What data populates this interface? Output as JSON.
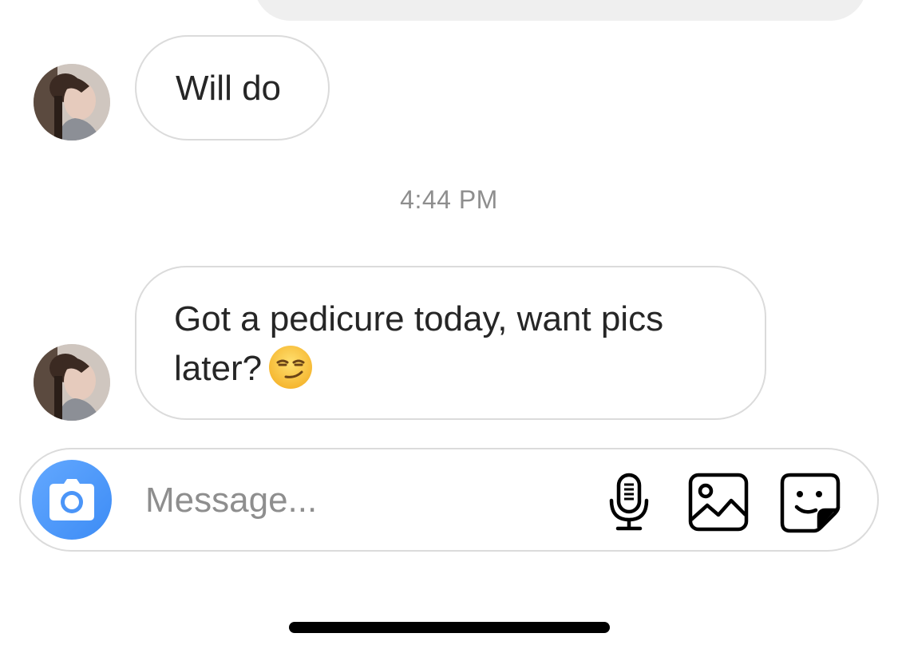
{
  "thread": {
    "messages": [
      {
        "text": "Will do"
      },
      {
        "text": "Got a pedicure today, want pics later?",
        "emoji": "smirking-face"
      }
    ],
    "timestamp": "4:44 PM"
  },
  "composer": {
    "placeholder": "Message...",
    "icons": [
      "camera-icon",
      "microphone-icon",
      "gallery-icon",
      "sticker-icon"
    ]
  },
  "colors": {
    "bubble_border": "#dbdbdb",
    "accent_blue": "#3d8cf5",
    "secondary_text": "#8e8e8e"
  }
}
